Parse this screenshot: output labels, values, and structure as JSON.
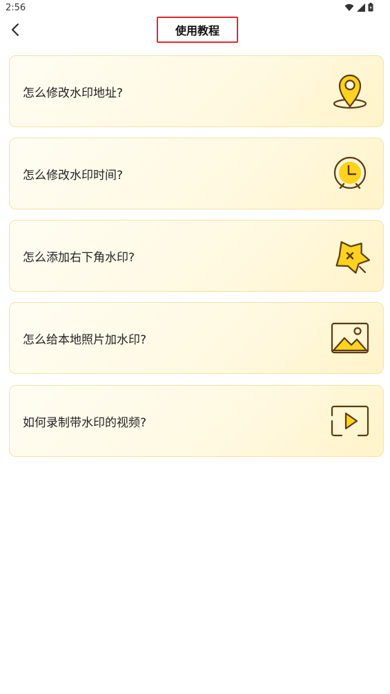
{
  "status_bar": {
    "time": "2:56",
    "icons": [
      "wifi-icon",
      "signal-icon",
      "battery-icon"
    ]
  },
  "header": {
    "back_icon": "chevron-left-icon",
    "title": "使用教程"
  },
  "tutorials": [
    {
      "label": "怎么修改水印地址?",
      "icon": "location-pin-icon"
    },
    {
      "label": "怎么修改水印时间?",
      "icon": "alarm-clock-icon"
    },
    {
      "label": "怎么添加右下角水印?",
      "icon": "star-icon"
    },
    {
      "label": "怎么给本地照片加水印?",
      "icon": "picture-icon"
    },
    {
      "label": "如何录制带水印的视频?",
      "icon": "video-play-icon"
    }
  ],
  "colors": {
    "accent_yellow": "#FFD21F",
    "icon_stroke": "#5a3a12",
    "card_border": "#f2e3a8",
    "title_highlight_border": "#e0262a"
  }
}
